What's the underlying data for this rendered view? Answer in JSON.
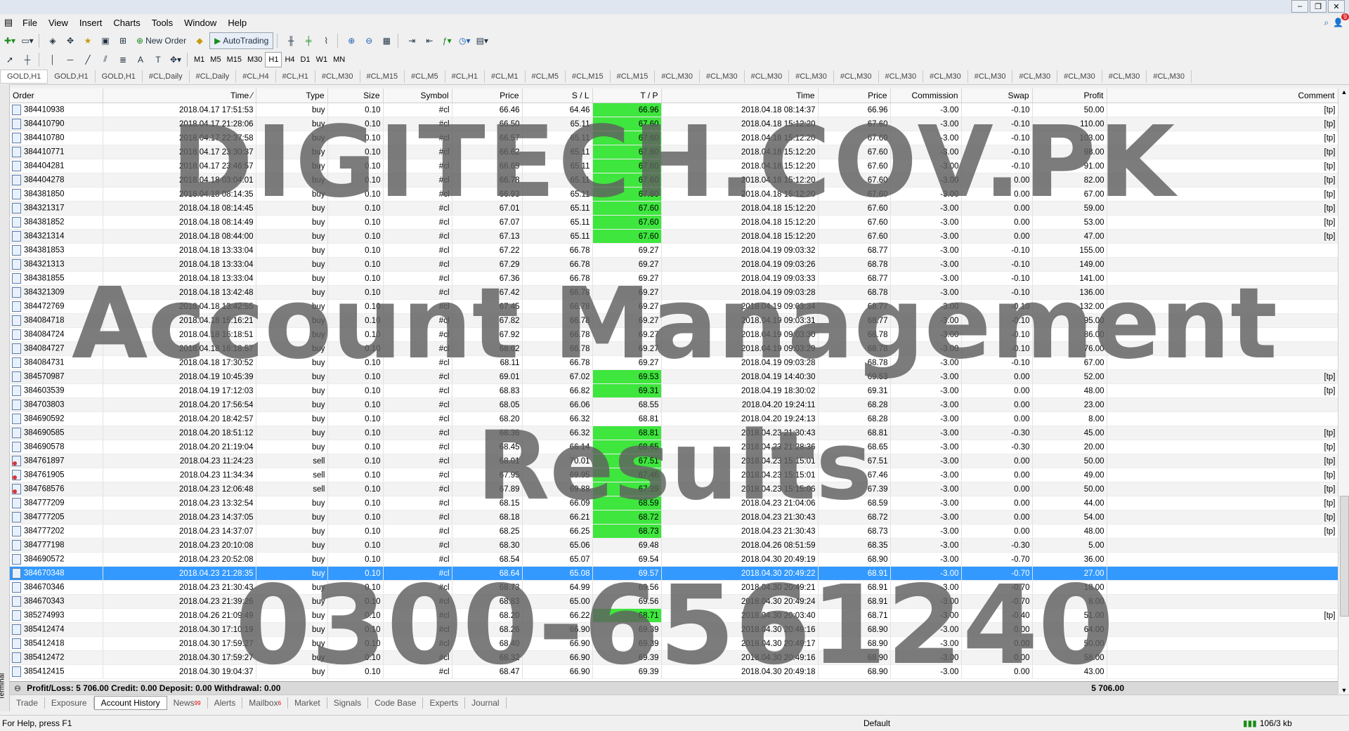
{
  "menu": [
    "File",
    "View",
    "Insert",
    "Charts",
    "Tools",
    "Window",
    "Help"
  ],
  "toolbar": {
    "new_order": "New Order",
    "autotrading": "AutoTrading",
    "timeframes": [
      "M1",
      "M5",
      "M15",
      "M30",
      "H1",
      "H4",
      "D1",
      "W1",
      "MN"
    ],
    "active_timeframe": "H1"
  },
  "chart_tabs": [
    "GOLD,H1",
    "GOLD,H1",
    "GOLD,H1",
    "#CL,Daily",
    "#CL,Daily",
    "#CL,H4",
    "#CL,H1",
    "#CL,M30",
    "#CL,M15",
    "#CL,M5",
    "#CL,H1",
    "#CL,M1",
    "#CL,M5",
    "#CL,M15",
    "#CL,M15",
    "#CL,M30",
    "#CL,M30",
    "#CL,M30",
    "#CL,M30",
    "#CL,M30",
    "#CL,M30",
    "#CL,M30",
    "#CL,M30",
    "#CL,M30",
    "#CL,M30",
    "#CL,M30",
    "#CL,M30"
  ],
  "columns": [
    "Order",
    "Time",
    "Type",
    "Size",
    "Symbol",
    "Price",
    "S / L",
    "T / P",
    "Time",
    "Price",
    "Commission",
    "Swap",
    "Profit",
    "Comment"
  ],
  "rows": [
    {
      "order": "384410938",
      "time": "2018.04.17 17:51:53",
      "type": "buy",
      "size": "0.10",
      "symbol": "#cl",
      "price": "66.46",
      "sl": "64.46",
      "tp": "66.96",
      "tp_hit": true,
      "ctime": "2018.04.18 08:14:37",
      "cprice": "66.96",
      "comm": "-3.00",
      "swap": "-0.10",
      "profit": "50.00",
      "comment": "[tp]"
    },
    {
      "order": "384410790",
      "time": "2018.04.17 21:28:06",
      "type": "buy",
      "size": "0.10",
      "symbol": "#cl",
      "price": "66.50",
      "sl": "65.11",
      "tp": "67.60",
      "tp_hit": true,
      "ctime": "2018.04.18 15:12:20",
      "cprice": "67.60",
      "comm": "-3.00",
      "swap": "-0.10",
      "profit": "110.00",
      "comment": "[tp]"
    },
    {
      "order": "384410780",
      "time": "2018.04.17 22:37:58",
      "type": "buy",
      "size": "0.10",
      "symbol": "#cl",
      "price": "66.57",
      "sl": "65.11",
      "tp": "67.60",
      "tp_hit": true,
      "ctime": "2018.04.18 15:12:20",
      "cprice": "67.60",
      "comm": "-3.00",
      "swap": "-0.10",
      "profit": "103.00",
      "comment": "[tp]"
    },
    {
      "order": "384410771",
      "time": "2018.04.17 23:30:37",
      "type": "buy",
      "size": "0.10",
      "symbol": "#cl",
      "price": "66.62",
      "sl": "65.11",
      "tp": "67.60",
      "tp_hit": true,
      "ctime": "2018.04.18 15:12:20",
      "cprice": "67.60",
      "comm": "-3.00",
      "swap": "-0.10",
      "profit": "98.00",
      "comment": "[tp]"
    },
    {
      "order": "384404281",
      "time": "2018.04.17 23:46:57",
      "type": "buy",
      "size": "0.10",
      "symbol": "#cl",
      "price": "66.69",
      "sl": "65.11",
      "tp": "67.60",
      "tp_hit": true,
      "ctime": "2018.04.18 15:12:20",
      "cprice": "67.60",
      "comm": "-3.00",
      "swap": "-0.10",
      "profit": "91.00",
      "comment": "[tp]"
    },
    {
      "order": "384404278",
      "time": "2018.04.18 03:04:01",
      "type": "buy",
      "size": "0.10",
      "symbol": "#cl",
      "price": "66.78",
      "sl": "65.11",
      "tp": "67.60",
      "tp_hit": true,
      "ctime": "2018.04.18 15:12:20",
      "cprice": "67.60",
      "comm": "-3.00",
      "swap": "0.00",
      "profit": "82.00",
      "comment": "[tp]"
    },
    {
      "order": "384381850",
      "time": "2018.04.18 08:14:35",
      "type": "buy",
      "size": "0.10",
      "symbol": "#cl",
      "price": "66.93",
      "sl": "65.11",
      "tp": "67.60",
      "tp_hit": true,
      "ctime": "2018.04.18 15:12:20",
      "cprice": "67.60",
      "comm": "-3.00",
      "swap": "0.00",
      "profit": "67.00",
      "comment": "[tp]"
    },
    {
      "order": "384321317",
      "time": "2018.04.18 08:14:45",
      "type": "buy",
      "size": "0.10",
      "symbol": "#cl",
      "price": "67.01",
      "sl": "65.11",
      "tp": "67.60",
      "tp_hit": true,
      "ctime": "2018.04.18 15:12:20",
      "cprice": "67.60",
      "comm": "-3.00",
      "swap": "0.00",
      "profit": "59.00",
      "comment": "[tp]"
    },
    {
      "order": "384381852",
      "time": "2018.04.18 08:14:49",
      "type": "buy",
      "size": "0.10",
      "symbol": "#cl",
      "price": "67.07",
      "sl": "65.11",
      "tp": "67.60",
      "tp_hit": true,
      "ctime": "2018.04.18 15:12:20",
      "cprice": "67.60",
      "comm": "-3.00",
      "swap": "0.00",
      "profit": "53.00",
      "comment": "[tp]"
    },
    {
      "order": "384321314",
      "time": "2018.04.18 08:44:00",
      "type": "buy",
      "size": "0.10",
      "symbol": "#cl",
      "price": "67.13",
      "sl": "65.11",
      "tp": "67.60",
      "tp_hit": true,
      "ctime": "2018.04.18 15:12:20",
      "cprice": "67.60",
      "comm": "-3.00",
      "swap": "0.00",
      "profit": "47.00",
      "comment": "[tp]"
    },
    {
      "order": "384381853",
      "time": "2018.04.18 13:33:04",
      "type": "buy",
      "size": "0.10",
      "symbol": "#cl",
      "price": "67.22",
      "sl": "66.78",
      "tp": "69.27",
      "tp_hit": false,
      "ctime": "2018.04.19 09:03:32",
      "cprice": "68.77",
      "comm": "-3.00",
      "swap": "-0.10",
      "profit": "155.00",
      "comment": ""
    },
    {
      "order": "384321313",
      "time": "2018.04.18 13:33:04",
      "type": "buy",
      "size": "0.10",
      "symbol": "#cl",
      "price": "67.29",
      "sl": "66.78",
      "tp": "69.27",
      "tp_hit": false,
      "ctime": "2018.04.19 09:03:26",
      "cprice": "68.78",
      "comm": "-3.00",
      "swap": "-0.10",
      "profit": "149.00",
      "comment": ""
    },
    {
      "order": "384381855",
      "time": "2018.04.18 13:33:04",
      "type": "buy",
      "size": "0.10",
      "symbol": "#cl",
      "price": "67.36",
      "sl": "66.78",
      "tp": "69.27",
      "tp_hit": false,
      "ctime": "2018.04.19 09:03:33",
      "cprice": "68.77",
      "comm": "-3.00",
      "swap": "-0.10",
      "profit": "141.00",
      "comment": ""
    },
    {
      "order": "384321309",
      "time": "2018.04.18 13:42:48",
      "type": "buy",
      "size": "0.10",
      "symbol": "#cl",
      "price": "67.42",
      "sl": "66.78",
      "tp": "69.27",
      "tp_hit": false,
      "ctime": "2018.04.19 09:03:28",
      "cprice": "68.78",
      "comm": "-3.00",
      "swap": "-0.10",
      "profit": "136.00",
      "comment": ""
    },
    {
      "order": "384472769",
      "time": "2018.04.18 13:42:55",
      "type": "buy",
      "size": "0.10",
      "symbol": "#cl",
      "price": "67.45",
      "sl": "66.78",
      "tp": "69.27",
      "tp_hit": false,
      "ctime": "2018.04.19 09:03:34",
      "cprice": "68.77",
      "comm": "-3.00",
      "swap": "-0.10",
      "profit": "132.00",
      "comment": ""
    },
    {
      "order": "384084718",
      "time": "2018.04.18 15:16:21",
      "type": "buy",
      "size": "0.10",
      "symbol": "#cl",
      "price": "67.82",
      "sl": "66.78",
      "tp": "69.27",
      "tp_hit": false,
      "ctime": "2018.04.19 09:03:31",
      "cprice": "68.77",
      "comm": "-3.00",
      "swap": "-0.10",
      "profit": "95.00",
      "comment": ""
    },
    {
      "order": "384084724",
      "time": "2018.04.18 16:18:51",
      "type": "buy",
      "size": "0.10",
      "symbol": "#cl",
      "price": "67.92",
      "sl": "66.78",
      "tp": "69.27",
      "tp_hit": false,
      "ctime": "2018.04.19 09:03:30",
      "cprice": "68.78",
      "comm": "-3.00",
      "swap": "-0.10",
      "profit": "86.00",
      "comment": ""
    },
    {
      "order": "384084727",
      "time": "2018.04.18 16:18:57",
      "type": "buy",
      "size": "0.10",
      "symbol": "#cl",
      "price": "68.02",
      "sl": "66.78",
      "tp": "69.27",
      "tp_hit": false,
      "ctime": "2018.04.19 09:03:29",
      "cprice": "68.78",
      "comm": "-3.00",
      "swap": "-0.10",
      "profit": "76.00",
      "comment": ""
    },
    {
      "order": "384084731",
      "time": "2018.04.18 17:30:52",
      "type": "buy",
      "size": "0.10",
      "symbol": "#cl",
      "price": "68.11",
      "sl": "66.78",
      "tp": "69.27",
      "tp_hit": false,
      "ctime": "2018.04.19 09:03:28",
      "cprice": "68.78",
      "comm": "-3.00",
      "swap": "-0.10",
      "profit": "67.00",
      "comment": ""
    },
    {
      "order": "384570987",
      "time": "2018.04.19 10:45:39",
      "type": "buy",
      "size": "0.10",
      "symbol": "#cl",
      "price": "69.01",
      "sl": "67.02",
      "tp": "69.53",
      "tp_hit": true,
      "ctime": "2018.04.19 14:40:30",
      "cprice": "69.53",
      "comm": "-3.00",
      "swap": "0.00",
      "profit": "52.00",
      "comment": "[tp]"
    },
    {
      "order": "384603539",
      "time": "2018.04.19 17:12:03",
      "type": "buy",
      "size": "0.10",
      "symbol": "#cl",
      "price": "68.83",
      "sl": "66.82",
      "tp": "69.31",
      "tp_hit": true,
      "ctime": "2018.04.19 18:30:02",
      "cprice": "69.31",
      "comm": "-3.00",
      "swap": "0.00",
      "profit": "48.00",
      "comment": "[tp]"
    },
    {
      "order": "384703803",
      "time": "2018.04.20 17:56:54",
      "type": "buy",
      "size": "0.10",
      "symbol": "#cl",
      "price": "68.05",
      "sl": "66.06",
      "tp": "68.55",
      "tp_hit": false,
      "ctime": "2018.04.20 19:24:11",
      "cprice": "68.28",
      "comm": "-3.00",
      "swap": "0.00",
      "profit": "23.00",
      "comment": ""
    },
    {
      "order": "384690592",
      "time": "2018.04.20 18:42:57",
      "type": "buy",
      "size": "0.10",
      "symbol": "#cl",
      "price": "68.20",
      "sl": "66.32",
      "tp": "68.81",
      "tp_hit": false,
      "ctime": "2018.04.20 19:24:13",
      "cprice": "68.28",
      "comm": "-3.00",
      "swap": "0.00",
      "profit": "8.00",
      "comment": ""
    },
    {
      "order": "384690585",
      "time": "2018.04.20 18:51:12",
      "type": "buy",
      "size": "0.10",
      "symbol": "#cl",
      "price": "68.36",
      "sl": "66.32",
      "tp": "68.81",
      "tp_hit": true,
      "ctime": "2018.04.23 21:30:43",
      "cprice": "68.81",
      "comm": "-3.00",
      "swap": "-0.30",
      "profit": "45.00",
      "comment": "[tp]"
    },
    {
      "order": "384690578",
      "time": "2018.04.20 21:19:04",
      "type": "buy",
      "size": "0.10",
      "symbol": "#cl",
      "price": "68.45",
      "sl": "66.14",
      "tp": "68.65",
      "tp_hit": true,
      "ctime": "2018.04.23 21:28:36",
      "cprice": "68.65",
      "comm": "-3.00",
      "swap": "-0.30",
      "profit": "20.00",
      "comment": "[tp]"
    },
    {
      "order": "384761897",
      "time": "2018.04.23 11:24:23",
      "type": "sell",
      "size": "0.10",
      "symbol": "#cl",
      "price": "68.01",
      "sl": "70.01",
      "tp": "67.51",
      "tp_hit": true,
      "ctime": "2018.04.23 15:15:01",
      "cprice": "67.51",
      "comm": "-3.00",
      "swap": "0.00",
      "profit": "50.00",
      "comment": "[tp]"
    },
    {
      "order": "384761905",
      "time": "2018.04.23 11:34:34",
      "type": "sell",
      "size": "0.10",
      "symbol": "#cl",
      "price": "67.95",
      "sl": "69.95",
      "tp": "67.46",
      "tp_hit": true,
      "ctime": "2018.04.23 15:15:01",
      "cprice": "67.46",
      "comm": "-3.00",
      "swap": "0.00",
      "profit": "49.00",
      "comment": "[tp]"
    },
    {
      "order": "384768576",
      "time": "2018.04.23 12:06:48",
      "type": "sell",
      "size": "0.10",
      "symbol": "#cl",
      "price": "67.89",
      "sl": "69.88",
      "tp": "67.39",
      "tp_hit": true,
      "ctime": "2018.04.23 15:15:06",
      "cprice": "67.39",
      "comm": "-3.00",
      "swap": "0.00",
      "profit": "50.00",
      "comment": "[tp]"
    },
    {
      "order": "384777209",
      "time": "2018.04.23 13:32:54",
      "type": "buy",
      "size": "0.10",
      "symbol": "#cl",
      "price": "68.15",
      "sl": "66.09",
      "tp": "68.59",
      "tp_hit": true,
      "ctime": "2018.04.23 21:04:06",
      "cprice": "68.59",
      "comm": "-3.00",
      "swap": "0.00",
      "profit": "44.00",
      "comment": "[tp]"
    },
    {
      "order": "384777205",
      "time": "2018.04.23 14:37:05",
      "type": "buy",
      "size": "0.10",
      "symbol": "#cl",
      "price": "68.18",
      "sl": "66.21",
      "tp": "68.72",
      "tp_hit": true,
      "ctime": "2018.04.23 21:30:43",
      "cprice": "68.72",
      "comm": "-3.00",
      "swap": "0.00",
      "profit": "54.00",
      "comment": "[tp]"
    },
    {
      "order": "384777202",
      "time": "2018.04.23 14:37:07",
      "type": "buy",
      "size": "0.10",
      "symbol": "#cl",
      "price": "68.25",
      "sl": "66.25",
      "tp": "68.73",
      "tp_hit": true,
      "ctime": "2018.04.23 21:30:43",
      "cprice": "68.73",
      "comm": "-3.00",
      "swap": "0.00",
      "profit": "48.00",
      "comment": "[tp]"
    },
    {
      "order": "384777198",
      "time": "2018.04.23 20:10:08",
      "type": "buy",
      "size": "0.10",
      "symbol": "#cl",
      "price": "68.30",
      "sl": "65.06",
      "tp": "69.48",
      "tp_hit": false,
      "ctime": "2018.04.26 08:51:59",
      "cprice": "68.35",
      "comm": "-3.00",
      "swap": "-0.30",
      "profit": "5.00",
      "comment": ""
    },
    {
      "order": "384690572",
      "time": "2018.04.23 20:52:08",
      "type": "buy",
      "size": "0.10",
      "symbol": "#cl",
      "price": "68.54",
      "sl": "65.07",
      "tp": "69.54",
      "tp_hit": false,
      "ctime": "2018.04.30 20:49:19",
      "cprice": "68.90",
      "comm": "-3.00",
      "swap": "-0.70",
      "profit": "36.00",
      "comment": ""
    },
    {
      "order": "384670348",
      "time": "2018.04.23 21:28:35",
      "type": "buy",
      "size": "0.10",
      "symbol": "#cl",
      "price": "68.64",
      "sl": "65.08",
      "tp": "69.57",
      "tp_hit": false,
      "ctime": "2018.04.30 20:49:22",
      "cprice": "68.91",
      "comm": "-3.00",
      "swap": "-0.70",
      "profit": "27.00",
      "comment": "",
      "selected": true
    },
    {
      "order": "384670346",
      "time": "2018.04.23 21:30:43",
      "type": "buy",
      "size": "0.10",
      "symbol": "#cl",
      "price": "68.73",
      "sl": "64.99",
      "tp": "69.56",
      "tp_hit": false,
      "ctime": "2018.04.30 20:49:21",
      "cprice": "68.91",
      "comm": "-3.00",
      "swap": "-0.70",
      "profit": "18.00",
      "comment": ""
    },
    {
      "order": "384670343",
      "time": "2018.04.23 21:39:26",
      "type": "buy",
      "size": "0.10",
      "symbol": "#cl",
      "price": "68.83",
      "sl": "65.00",
      "tp": "69.56",
      "tp_hit": false,
      "ctime": "2018.04.30 20:49:24",
      "cprice": "68.91",
      "comm": "-3.00",
      "swap": "-0.70",
      "profit": "8.00",
      "comment": ""
    },
    {
      "order": "385274993",
      "time": "2018.04.26 21:09:49",
      "type": "buy",
      "size": "0.10",
      "symbol": "#cl",
      "price": "68.20",
      "sl": "66.22",
      "tp": "68.71",
      "tp_hit": true,
      "ctime": "2018.04.30 20:03:40",
      "cprice": "68.71",
      "comm": "-3.00",
      "swap": "-0.40",
      "profit": "51.00",
      "comment": "[tp]"
    },
    {
      "order": "385412474",
      "time": "2018.04.30 17:10:19",
      "type": "buy",
      "size": "0.10",
      "symbol": "#cl",
      "price": "68.26",
      "sl": "66.90",
      "tp": "69.39",
      "tp_hit": false,
      "ctime": "2018.04.30 20:49:16",
      "cprice": "68.90",
      "comm": "-3.00",
      "swap": "0.00",
      "profit": "64.00",
      "comment": ""
    },
    {
      "order": "385412418",
      "time": "2018.04.30 17:59:27",
      "type": "buy",
      "size": "0.10",
      "symbol": "#cl",
      "price": "68.40",
      "sl": "66.90",
      "tp": "69.39",
      "tp_hit": false,
      "ctime": "2018.04.30 20:49:17",
      "cprice": "68.90",
      "comm": "-3.00",
      "swap": "0.00",
      "profit": "50.00",
      "comment": ""
    },
    {
      "order": "385412472",
      "time": "2018.04.30 17:59:27",
      "type": "buy",
      "size": "0.10",
      "symbol": "#cl",
      "price": "68.32",
      "sl": "66.90",
      "tp": "69.39",
      "tp_hit": false,
      "ctime": "2018.04.30 20:49:16",
      "cprice": "68.90",
      "comm": "-3.00",
      "swap": "0.00",
      "profit": "58.00",
      "comment": ""
    },
    {
      "order": "385412415",
      "time": "2018.04.30 19:04:37",
      "type": "buy",
      "size": "0.10",
      "symbol": "#cl",
      "price": "68.47",
      "sl": "66.90",
      "tp": "69.39",
      "tp_hit": false,
      "ctime": "2018.04.30 20:49:18",
      "cprice": "68.90",
      "comm": "-3.00",
      "swap": "0.00",
      "profit": "43.00",
      "comment": ""
    }
  ],
  "summary": {
    "text": "Profit/Loss: 5 706.00  Credit: 0.00  Deposit: 0.00  Withdrawal: 0.00",
    "total": "5 706.00"
  },
  "bottom_tabs": [
    {
      "label": "Trade",
      "badge": ""
    },
    {
      "label": "Exposure",
      "badge": ""
    },
    {
      "label": "Account History",
      "badge": "",
      "active": true
    },
    {
      "label": "News",
      "badge": "99"
    },
    {
      "label": "Alerts",
      "badge": ""
    },
    {
      "label": "Mailbox",
      "badge": "6"
    },
    {
      "label": "Market",
      "badge": ""
    },
    {
      "label": "Signals",
      "badge": ""
    },
    {
      "label": "Code Base",
      "badge": ""
    },
    {
      "label": "Experts",
      "badge": ""
    },
    {
      "label": "Journal",
      "badge": ""
    }
  ],
  "terminal_label": "Terminal",
  "status": {
    "help": "For Help, press F1",
    "profile": "Default",
    "traffic": "106/3 kb"
  },
  "notification_count": "9",
  "watermark": [
    "DIGITECH.COV.PK",
    "Account Management",
    "Results",
    "0300-6561240"
  ]
}
